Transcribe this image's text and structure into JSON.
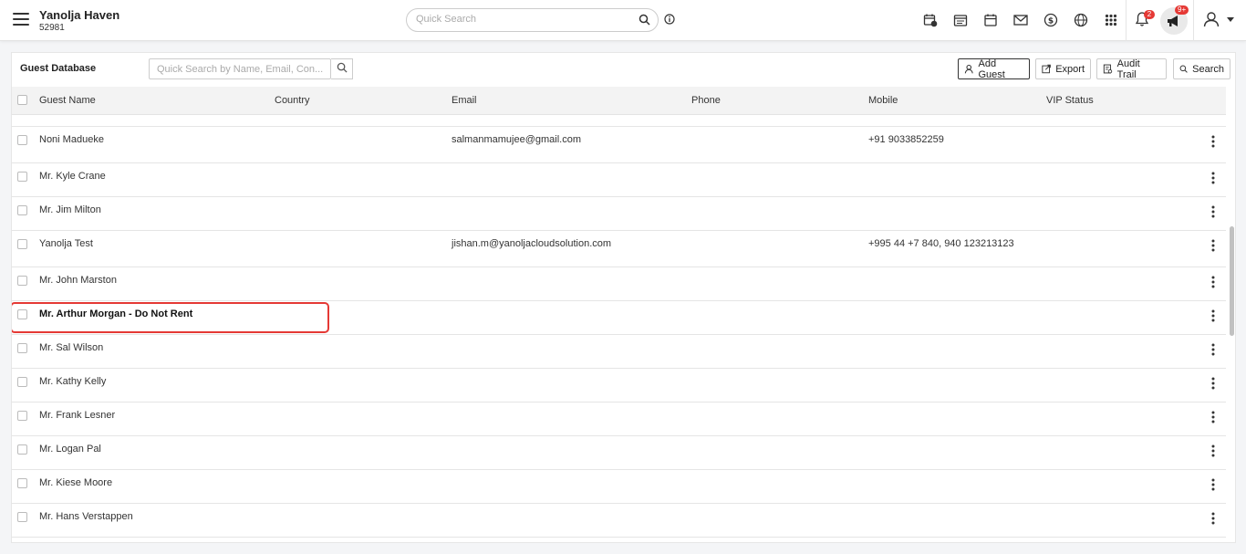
{
  "header": {
    "property_name": "Yanolja Haven",
    "property_id": "52981",
    "quick_search_placeholder": "Quick Search",
    "notification_count": "2",
    "announcement_count": "9+"
  },
  "panel": {
    "title": "Guest Database",
    "search_placeholder": "Quick Search by Name, Email, Con...",
    "buttons": {
      "add_guest": "Add Guest",
      "export": "Export",
      "audit_trail": "Audit Trail",
      "search": "Search"
    }
  },
  "table": {
    "columns": [
      "Guest Name",
      "Country",
      "Email",
      "Phone",
      "Mobile",
      "VIP Status"
    ],
    "rows": [
      {
        "name": "Noni Madueke",
        "email": "salmanmamujee@gmail.com",
        "mobile": "+91 9033852259"
      },
      {
        "name": "Mr. Kyle Crane",
        "email": "",
        "mobile": ""
      },
      {
        "name": "Mr. Jim Milton",
        "email": "",
        "mobile": ""
      },
      {
        "name": "Yanolja Test",
        "email": "jishan.m@yanoljacloudsolution.com",
        "mobile": "+995 44 +7 840, 940 123213123"
      },
      {
        "name": "Mr. John Marston",
        "email": "",
        "mobile": ""
      },
      {
        "name": "Mr. Arthur Morgan - Do Not Rent",
        "email": "",
        "mobile": ""
      },
      {
        "name": "Mr. Sal Wilson",
        "email": "",
        "mobile": ""
      },
      {
        "name": "Mr. Kathy Kelly",
        "email": "",
        "mobile": ""
      },
      {
        "name": "Mr. Frank Lesner",
        "email": "",
        "mobile": ""
      },
      {
        "name": "Mr. Logan Pal",
        "email": "",
        "mobile": ""
      },
      {
        "name": "Mr. Kiese Moore",
        "email": "",
        "mobile": ""
      },
      {
        "name": "Mr. Hans Verstappen",
        "email": "",
        "mobile": ""
      }
    ]
  },
  "colors": {
    "highlight": "#e53935",
    "badge": "#e53935"
  }
}
